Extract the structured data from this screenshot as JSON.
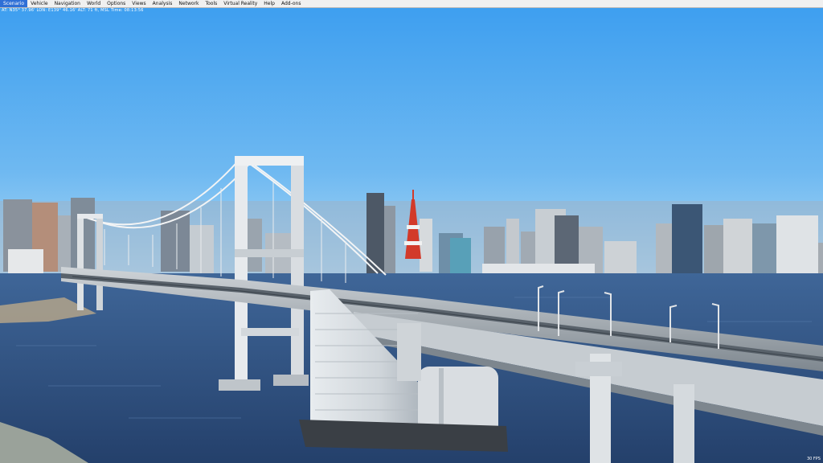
{
  "menu": {
    "items": [
      "Scenario",
      "Vehicle",
      "Navigation",
      "World",
      "Options",
      "Views",
      "Analysis",
      "Network",
      "Tools",
      "Virtual Reality",
      "Help",
      "Add-ons"
    ],
    "active_index": 0
  },
  "status_text": "AT: N35° 37.96' LON: E139° 46.16' ALT: 71 ft, MSL  Time: 08:13:56",
  "fps_text": "30 FPS",
  "scene": {
    "sky_top": "#3e9ff0",
    "sky_bottom": "#a9d7f6",
    "water": "#2f4f7f",
    "tower_red": "#d23a2a"
  }
}
